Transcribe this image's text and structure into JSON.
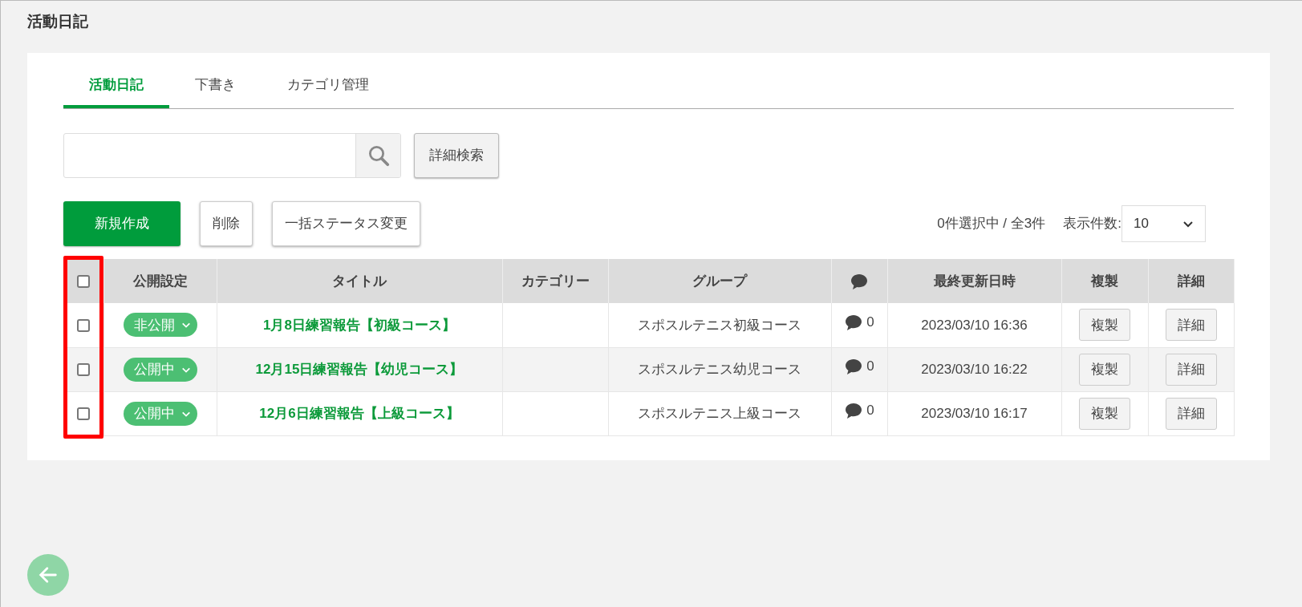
{
  "page_title": "活動日記",
  "tabs": [
    {
      "label": "活動日記",
      "selected": true
    },
    {
      "label": "下書き",
      "selected": false
    },
    {
      "label": "カテゴリ管理",
      "selected": false
    }
  ],
  "search": {
    "advanced_button": "詳細検索"
  },
  "actions": {
    "create": "新規作成",
    "delete": "削除",
    "bulk_status": "一括ステータス変更"
  },
  "selection_summary": "0件選択中 / 全3件",
  "page_size": {
    "label": "表示件数:",
    "value": "10"
  },
  "table": {
    "select_all_checked": false,
    "columns": [
      "公開設定",
      "タイトル",
      "カテゴリー",
      "グループ",
      "最終更新日時",
      "複製",
      "詳細"
    ],
    "rows": [
      {
        "checked": false,
        "status": "非公開",
        "title": "1月8日練習報告【初級コース】",
        "group": "スポスルテニス初級コース",
        "comments": "0",
        "updated": "2023/03/10 16:36",
        "copy_button": "複製",
        "detail_button": "詳細"
      },
      {
        "checked": false,
        "status": "公開中",
        "title": "12月15日練習報告【幼児コース】",
        "group": "スポスルテニス幼児コース",
        "comments": "0",
        "updated": "2023/03/10 16:22",
        "copy_button": "複製",
        "detail_button": "詳細"
      },
      {
        "checked": false,
        "status": "公開中",
        "title": "12月6日練習報告【上級コース】",
        "group": "スポスルテニス上級コース",
        "comments": "0",
        "updated": "2023/03/10 16:17",
        "copy_button": "複製",
        "detail_button": "詳細"
      }
    ]
  }
}
